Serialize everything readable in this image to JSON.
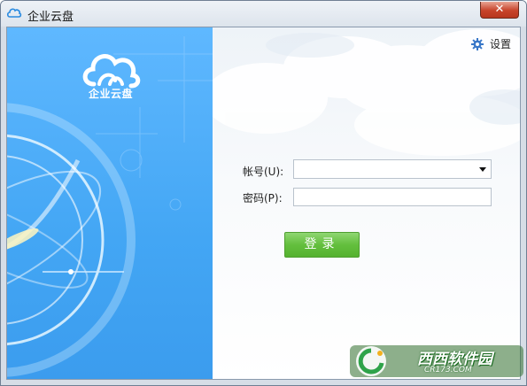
{
  "window": {
    "title": "企业云盘",
    "close_label": "✕"
  },
  "left_panel": {
    "logo_text": "企业云盘"
  },
  "settings": {
    "label": "设置",
    "icon": "gear-icon"
  },
  "form": {
    "account_label": "帐号(U):",
    "account_value": "",
    "password_label": "密码(P):",
    "password_value": "",
    "login_label": "登录"
  },
  "watermark": {
    "text": "西西软件园",
    "site": "CR173.COM"
  },
  "colors": {
    "left_panel": "#4aa9f7",
    "login_button": "#63bf3d",
    "close_button": "#c7432a"
  }
}
